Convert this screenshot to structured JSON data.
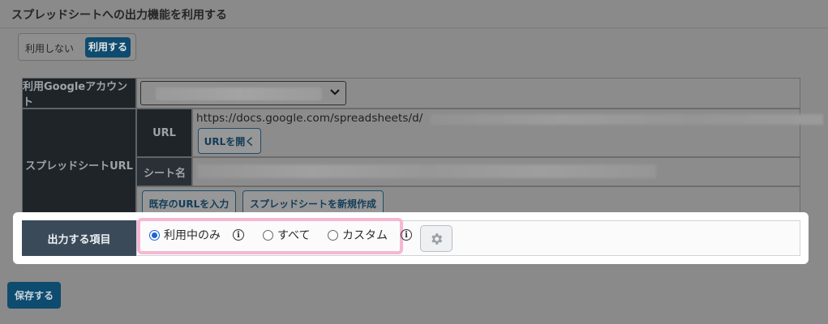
{
  "section": {
    "title": "スプレッドシートへの出力機能を利用する"
  },
  "toggle": {
    "off_label": "利用しない",
    "on_label": "利用する",
    "selected": "利用する"
  },
  "account": {
    "label": "利用Googleアカウント",
    "selected_value": ""
  },
  "spreadsheet": {
    "label": "スプレッドシートURL",
    "url_label": "URL",
    "url_value": "https://docs.google.com/spreadsheets/d/",
    "open_url_button": "URLを開く",
    "sheet_name_label": "シート名",
    "sheet_name_value": "",
    "enter_existing_button": "既存のURLを入力",
    "create_new_button": "スプレッドシートを新規作成"
  },
  "output": {
    "label": "出力する項目",
    "options": [
      {
        "label": "利用中のみ",
        "checked": true
      },
      {
        "label": "すべて",
        "checked": false
      },
      {
        "label": "カスタム",
        "checked": false
      }
    ],
    "settings_icon": "gear-icon",
    "info_icon": "info-icon"
  },
  "footer": {
    "save_button": "保存する"
  },
  "colors": {
    "primary": "#0d4b6f",
    "radio_checked": "#1c64d8",
    "highlight_frame": "#f7b7d3",
    "header_dark": "#1f2428"
  }
}
